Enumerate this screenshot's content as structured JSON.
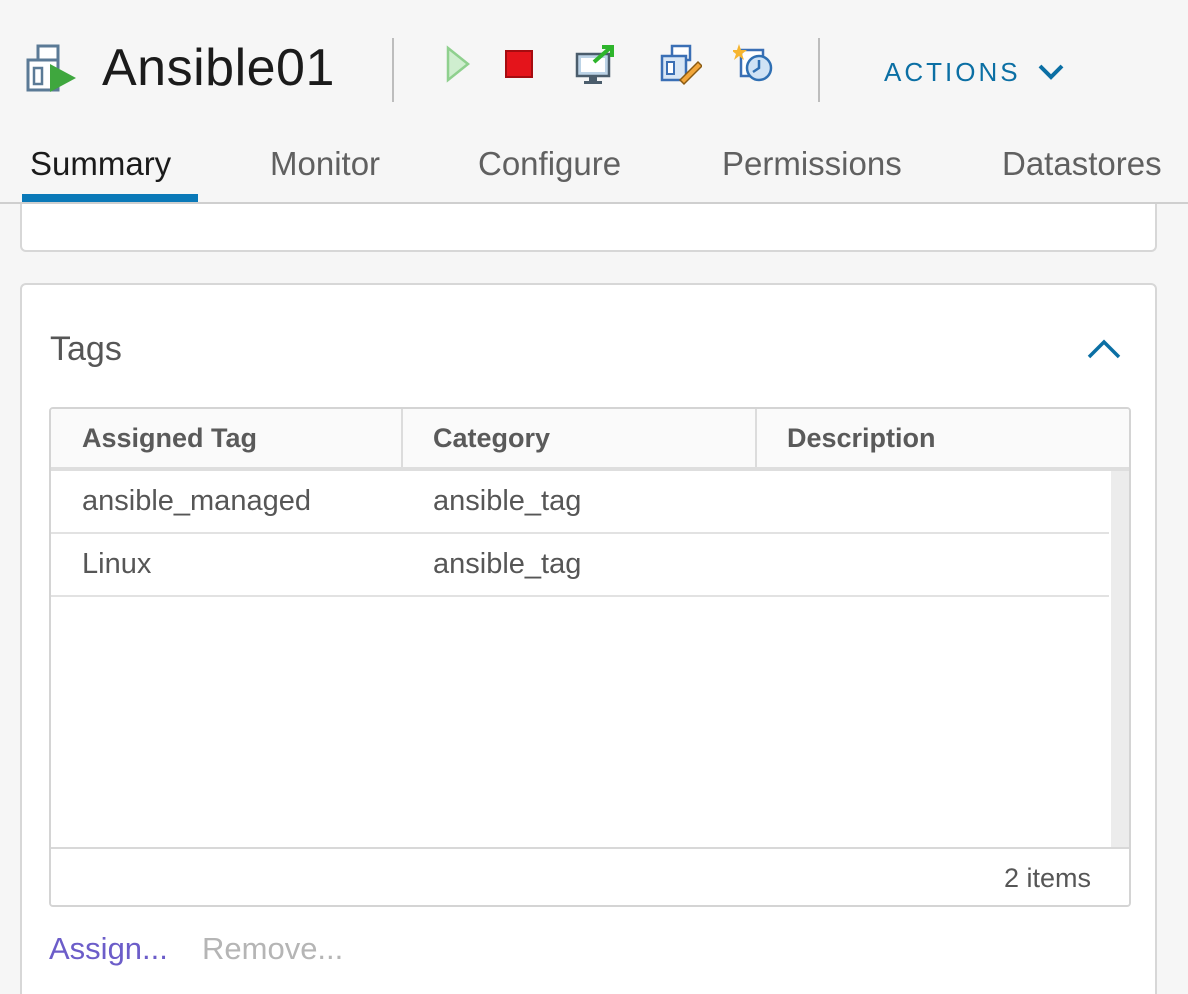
{
  "header": {
    "vm_name": "Ansible01",
    "icons": [
      "vm-icon",
      "power-on-icon",
      "power-off-icon",
      "console-icon",
      "edit-settings-icon",
      "snapshot-icon"
    ],
    "actions_label": "ACTIONS"
  },
  "tabs": [
    {
      "label": "Summary",
      "active": true
    },
    {
      "label": "Monitor",
      "active": false
    },
    {
      "label": "Configure",
      "active": false
    },
    {
      "label": "Permissions",
      "active": false
    },
    {
      "label": "Datastores",
      "active": false
    }
  ],
  "tags_card": {
    "title": "Tags",
    "columns": [
      "Assigned Tag",
      "Category",
      "Description"
    ],
    "rows": [
      {
        "tag": "ansible_managed",
        "category": "ansible_tag",
        "description": ""
      },
      {
        "tag": "Linux",
        "category": "ansible_tag",
        "description": ""
      }
    ],
    "footer": "2 items",
    "assign_label": "Assign...",
    "remove_label": "Remove..."
  },
  "colors": {
    "accent": "#0a79b8",
    "link": "#6c5dc9",
    "disabled": "#b5b5b5"
  }
}
